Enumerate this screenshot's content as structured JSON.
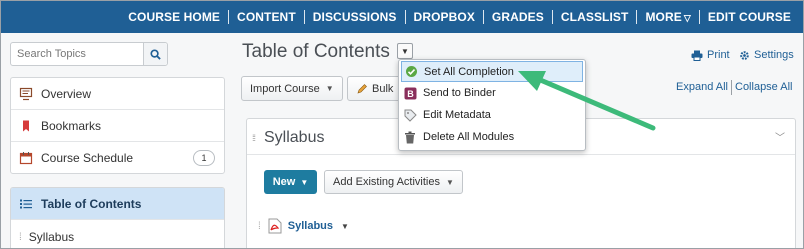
{
  "topnav": {
    "items": [
      "COURSE HOME",
      "CONTENT",
      "DISCUSSIONS",
      "DROPBOX",
      "GRADES",
      "CLASSLIST",
      "MORE",
      "EDIT COURSE"
    ]
  },
  "sidebar": {
    "search_placeholder": "Search Topics",
    "items": [
      {
        "label": "Overview",
        "icon": "overview-icon"
      },
      {
        "label": "Bookmarks",
        "icon": "bookmark-icon"
      },
      {
        "label": "Course Schedule",
        "icon": "calendar-icon",
        "badge": "1"
      }
    ],
    "toc": {
      "label": "Table of Contents",
      "icon": "list-icon"
    },
    "modules": [
      {
        "label": "Syllabus"
      }
    ]
  },
  "main": {
    "title": "Table of Contents",
    "print_label": "Print",
    "settings_label": "Settings",
    "import_label": "Import Course",
    "bulk_label": "Bulk",
    "expand_label": "Expand All",
    "collapse_label": "Collapse All",
    "module": {
      "title": "Syllabus",
      "new_label": "New",
      "add_existing_label": "Add Existing Activities",
      "items": [
        {
          "label": "Syllabus",
          "type": "pdf"
        }
      ]
    }
  },
  "menu": {
    "items": [
      {
        "label": "Set All Completion",
        "icon": "check-circle-icon",
        "active": true
      },
      {
        "label": "Send to Binder",
        "icon": "binder-icon"
      },
      {
        "label": "Edit Metadata",
        "icon": "tag-icon"
      },
      {
        "label": "Delete All Modules",
        "icon": "trash-icon"
      }
    ]
  },
  "colors": {
    "nav_bg": "#1f5f95",
    "accent": "#1e7ca0",
    "arrow": "#3dba7a",
    "selected": "#cfe3f6"
  }
}
